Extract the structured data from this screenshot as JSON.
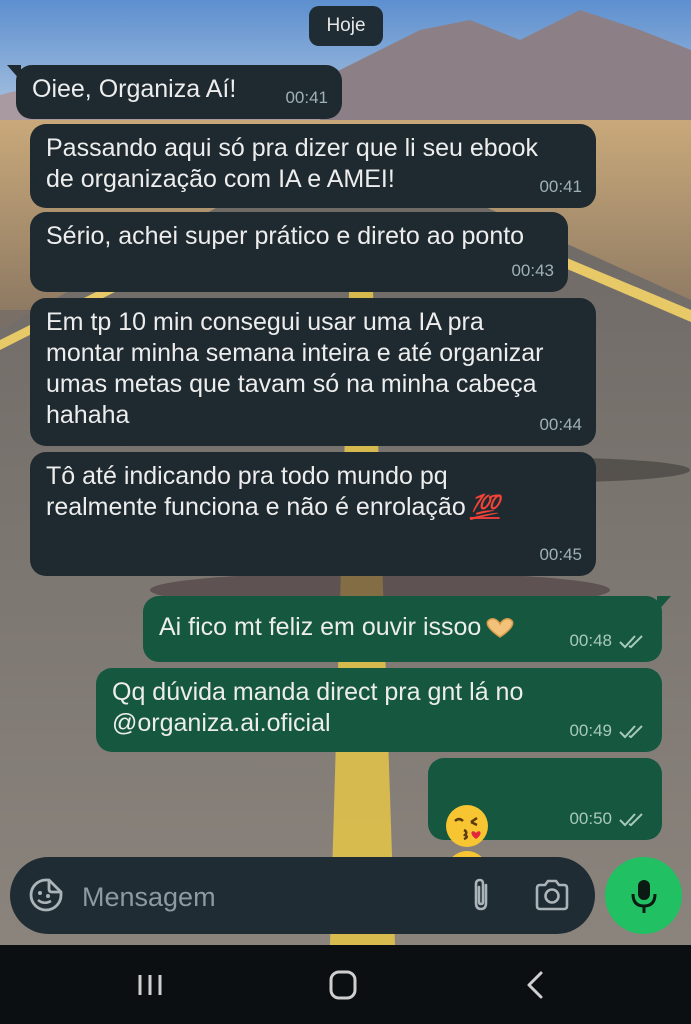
{
  "date_chip": "Hoje",
  "colors": {
    "incoming_bubble": "#1f2a30",
    "outgoing_bubble": "#15573f",
    "input_bar": "#1f2c33",
    "mic_button": "#21c063",
    "nav_bar": "#0b0f12"
  },
  "messages": [
    {
      "direction": "incoming",
      "text": "Oiee, Organiza Aí!",
      "time": "00:41"
    },
    {
      "direction": "incoming",
      "text": "Passando aqui só pra dizer que li seu ebook\nde organização com IA e AMEI!",
      "time": "00:41"
    },
    {
      "direction": "incoming",
      "text": "Sério, achei super prático e direto ao ponto",
      "time": "00:43"
    },
    {
      "direction": "incoming",
      "text": "Em tp 10 min consegui usar uma IA pra\nmontar minha semana inteira e até organizar\numas metas que tavam só na minha cabeça\nhahaha",
      "time": "00:44"
    },
    {
      "direction": "incoming",
      "text": "Tô até indicando pra todo mundo pq\nrealmente funciona e não é enrolação",
      "emoji": "hundred-points-emoji",
      "time": "00:45"
    },
    {
      "direction": "outgoing",
      "text": "Ai fico mt feliz em ouvir issoo",
      "emoji": "heart-hands-emoji",
      "time": "00:48",
      "status": "read"
    },
    {
      "direction": "outgoing",
      "text": "Qq dúvida manda direct pra gnt lá no\n@organiza.ai.oficial",
      "time": "00:49",
      "status": "read"
    },
    {
      "direction": "outgoing",
      "emoji": "kissing-face-emoji x2",
      "time": "00:50",
      "status": "read"
    }
  ],
  "input": {
    "placeholder": "Mensagem",
    "value": "",
    "icons": [
      "sticker-emoji-icon",
      "paperclip-icon",
      "camera-icon",
      "microphone-icon"
    ]
  },
  "nav_bar": {
    "icons": [
      "recent-apps-icon",
      "home-icon",
      "back-icon"
    ]
  }
}
